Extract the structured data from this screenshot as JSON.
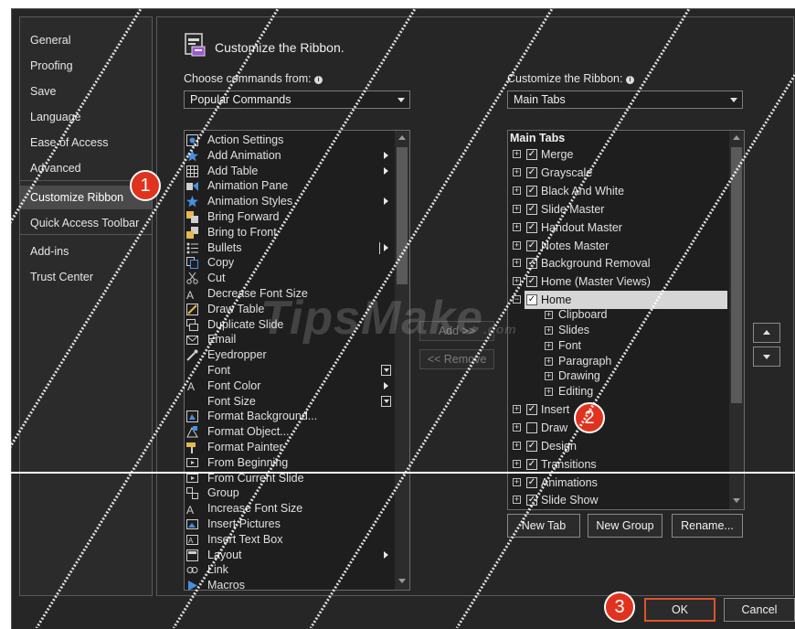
{
  "nav": {
    "items": [
      {
        "label": "General"
      },
      {
        "label": "Proofing"
      },
      {
        "label": "Save"
      },
      {
        "label": "Language"
      },
      {
        "label": "Ease of Access"
      },
      {
        "label": "Advanced"
      },
      {
        "label": "Customize Ribbon",
        "selected": true
      },
      {
        "label": "Quick Access Toolbar"
      },
      {
        "label": "Add-ins"
      },
      {
        "label": "Trust Center"
      }
    ]
  },
  "header": {
    "title": "Customize the Ribbon."
  },
  "commands": {
    "label": "Choose commands from:",
    "selected": "Popular Commands",
    "items": [
      {
        "label": "Action Settings",
        "icon": "action-settings-icon"
      },
      {
        "label": "Add Animation",
        "icon": "star-icon",
        "submenu": "arrow"
      },
      {
        "label": "Add Table",
        "icon": "table-icon",
        "submenu": "arrow"
      },
      {
        "label": "Animation Pane",
        "icon": "animation-pane-icon"
      },
      {
        "label": "Animation Styles",
        "icon": "star-icon",
        "submenu": "arrow"
      },
      {
        "label": "Bring Forward",
        "icon": "bring-forward-icon"
      },
      {
        "label": "Bring to Front",
        "icon": "bring-to-front-icon"
      },
      {
        "label": "Bullets",
        "icon": "bullets-icon",
        "submenu": "split"
      },
      {
        "label": "Copy",
        "icon": "copy-icon"
      },
      {
        "label": "Cut",
        "icon": "scissors-icon"
      },
      {
        "label": "Decrease Font Size",
        "icon": "decrease-font-icon"
      },
      {
        "label": "Draw Table",
        "icon": "draw-table-icon"
      },
      {
        "label": "Duplicate Slide",
        "icon": "duplicate-slide-icon"
      },
      {
        "label": "Email",
        "icon": "email-icon"
      },
      {
        "label": "Eyedropper",
        "icon": "eyedropper-icon"
      },
      {
        "label": "Font",
        "icon": "",
        "submenu": "box"
      },
      {
        "label": "Font Color",
        "icon": "font-color-icon",
        "submenu": "arrow"
      },
      {
        "label": "Font Size",
        "icon": "",
        "submenu": "box"
      },
      {
        "label": "Format Background...",
        "icon": "format-background-icon"
      },
      {
        "label": "Format Object...",
        "icon": "format-object-icon"
      },
      {
        "label": "Format Painter",
        "icon": "format-painter-icon"
      },
      {
        "label": "From Beginning",
        "icon": "from-beginning-icon"
      },
      {
        "label": "From Current Slide",
        "icon": "from-current-slide-icon"
      },
      {
        "label": "Group",
        "icon": "group-icon"
      },
      {
        "label": "Increase Font Size",
        "icon": "increase-font-icon"
      },
      {
        "label": "Insert Pictures",
        "icon": "picture-icon"
      },
      {
        "label": "Insert Text Box",
        "icon": "textbox-icon"
      },
      {
        "label": "Layout",
        "icon": "layout-icon",
        "submenu": "arrow"
      },
      {
        "label": "Link",
        "icon": "link-icon"
      },
      {
        "label": "Macros",
        "icon": "macros-icon"
      }
    ]
  },
  "ribbon": {
    "label": "Customize the Ribbon:",
    "selected": "Main Tabs",
    "list_header": "Main Tabs",
    "tabs": [
      {
        "label": "Merge",
        "checked": true,
        "expander": "+"
      },
      {
        "label": "Grayscale",
        "checked": true,
        "expander": "+"
      },
      {
        "label": "Black And White",
        "checked": true,
        "expander": "+"
      },
      {
        "label": "Slide Master",
        "checked": true,
        "expander": "+"
      },
      {
        "label": "Handout Master",
        "checked": true,
        "expander": "+"
      },
      {
        "label": "Notes Master",
        "checked": true,
        "expander": "+"
      },
      {
        "label": "Background Removal",
        "checked": true,
        "expander": "+"
      },
      {
        "label": "Home (Master Views)",
        "checked": true,
        "expander": "+"
      },
      {
        "label": "Home",
        "checked": true,
        "expander": "−",
        "selected": true
      }
    ],
    "home_groups": [
      {
        "label": "Clipboard"
      },
      {
        "label": "Slides"
      },
      {
        "label": "Font"
      },
      {
        "label": "Paragraph"
      },
      {
        "label": "Drawing"
      },
      {
        "label": "Editing"
      }
    ],
    "more_tabs": [
      {
        "label": "Insert",
        "checked": true
      },
      {
        "label": "Draw",
        "checked": false
      },
      {
        "label": "Design",
        "checked": true
      },
      {
        "label": "Transitions",
        "checked": true
      },
      {
        "label": "Animations",
        "checked": true
      },
      {
        "label": "Slide Show",
        "checked": true
      }
    ]
  },
  "buttons": {
    "add": "Add >>",
    "remove": "<< Remove",
    "new_tab": "New Tab",
    "new_group": "New Group",
    "rename": "Rename...",
    "ok": "OK",
    "cancel": "Cancel"
  },
  "annotations": {
    "step1": "1",
    "step2": "2",
    "step3": "3"
  },
  "watermark": {
    "text": "TipsMake",
    "suffix": ".com"
  },
  "colors": {
    "accent": "#e0331f",
    "ok_border": "#e0532a",
    "dialog_bg": "#262626"
  }
}
